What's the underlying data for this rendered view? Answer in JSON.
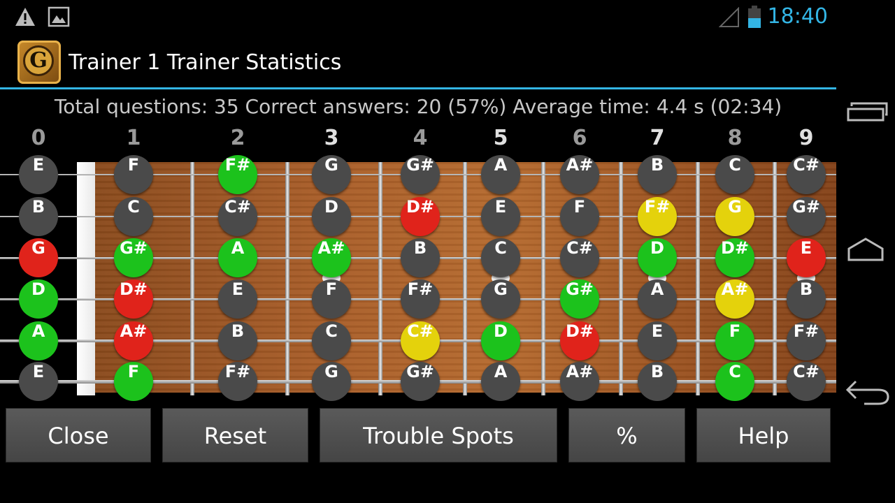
{
  "status": {
    "time": "18:40",
    "icons": [
      "warning-icon",
      "image-icon",
      "signal-icon",
      "battery-icon"
    ]
  },
  "header": {
    "title": "Trainer 1 Trainer Statistics"
  },
  "stats": {
    "text": "Total questions: 35 Correct answers: 20 (57%) Average time: 4.4 s (02:34)"
  },
  "fretboard": {
    "fret_numbers": [
      "0",
      "1",
      "2",
      "3",
      "4",
      "5",
      "6",
      "7",
      "8",
      "9"
    ],
    "highlighted_frets": [
      3,
      5,
      7,
      9
    ],
    "strings": [
      {
        "notes": [
          [
            "E",
            "dark"
          ],
          [
            "F",
            "dark"
          ],
          [
            "F#",
            "green"
          ],
          [
            "G",
            "dark"
          ],
          [
            "G#",
            "dark"
          ],
          [
            "A",
            "dark"
          ],
          [
            "A#",
            "dark"
          ],
          [
            "B",
            "dark"
          ],
          [
            "C",
            "dark"
          ],
          [
            "C#",
            "dark"
          ]
        ]
      },
      {
        "notes": [
          [
            "B",
            "dark"
          ],
          [
            "C",
            "dark"
          ],
          [
            "C#",
            "dark"
          ],
          [
            "D",
            "dark"
          ],
          [
            "D#",
            "red"
          ],
          [
            "E",
            "dark"
          ],
          [
            "F",
            "dark"
          ],
          [
            "F#",
            "yellow"
          ],
          [
            "G",
            "yellow"
          ],
          [
            "G#",
            "dark"
          ]
        ]
      },
      {
        "notes": [
          [
            "G",
            "red"
          ],
          [
            "G#",
            "green"
          ],
          [
            "A",
            "green"
          ],
          [
            "A#",
            "green"
          ],
          [
            "B",
            "dark"
          ],
          [
            "C",
            "dark"
          ],
          [
            "C#",
            "dark"
          ],
          [
            "D",
            "green"
          ],
          [
            "D#",
            "green"
          ],
          [
            "E",
            "red"
          ]
        ]
      },
      {
        "notes": [
          [
            "D",
            "green"
          ],
          [
            "D#",
            "red"
          ],
          [
            "E",
            "dark"
          ],
          [
            "F",
            "dark"
          ],
          [
            "F#",
            "dark"
          ],
          [
            "G",
            "dark"
          ],
          [
            "G#",
            "green"
          ],
          [
            "A",
            "dark"
          ],
          [
            "A#",
            "yellow"
          ],
          [
            "B",
            "dark"
          ]
        ]
      },
      {
        "notes": [
          [
            "A",
            "green"
          ],
          [
            "A#",
            "red"
          ],
          [
            "B",
            "dark"
          ],
          [
            "C",
            "dark"
          ],
          [
            "C#",
            "yellow"
          ],
          [
            "D",
            "green"
          ],
          [
            "D#",
            "red"
          ],
          [
            "E",
            "dark"
          ],
          [
            "F",
            "green"
          ],
          [
            "F#",
            "dark"
          ]
        ]
      },
      {
        "notes": [
          [
            "E",
            "dark"
          ],
          [
            "F",
            "green"
          ],
          [
            "F#",
            "dark"
          ],
          [
            "G",
            "dark"
          ],
          [
            "G#",
            "dark"
          ],
          [
            "A",
            "dark"
          ],
          [
            "A#",
            "dark"
          ],
          [
            "B",
            "dark"
          ],
          [
            "C",
            "green"
          ],
          [
            "C#",
            "dark"
          ]
        ]
      }
    ]
  },
  "colors": {
    "accent": "#33b5e5",
    "dark": "#4a4a4a",
    "green": "#1cc21c",
    "red": "#e0231b",
    "yellow": "#e4d20c"
  },
  "buttons": [
    {
      "id": "close",
      "label": "Close"
    },
    {
      "id": "reset",
      "label": "Reset"
    },
    {
      "id": "trouble-spots",
      "label": "Trouble Spots"
    },
    {
      "id": "percent",
      "label": "%"
    },
    {
      "id": "help",
      "label": "Help"
    }
  ],
  "navbar": [
    "recent-apps-icon",
    "home-icon",
    "back-icon"
  ]
}
